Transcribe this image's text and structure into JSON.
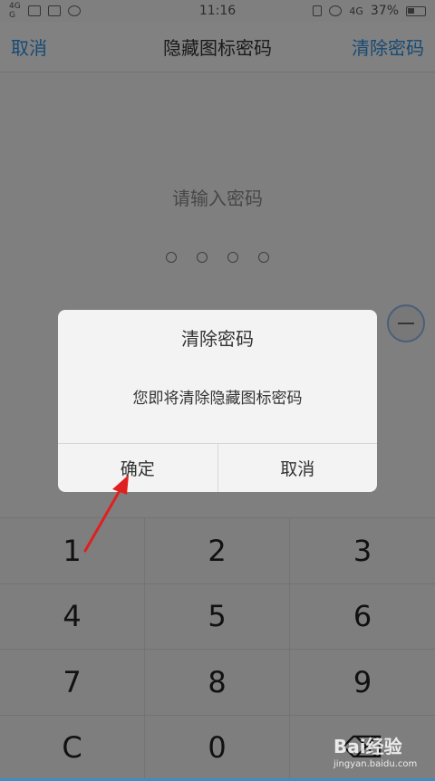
{
  "status_bar": {
    "signal_top": "4G",
    "signal_bottom": "G",
    "time": "11:16",
    "network": "4G",
    "battery": "37%",
    "icons": [
      "image-icon",
      "k-icon",
      "shield-icon",
      "vibrate-icon",
      "alarm-icon",
      "battery-icon"
    ]
  },
  "header": {
    "left_action": "取消",
    "title": "隐藏图标密码",
    "right_action": "清除密码"
  },
  "prompt": "请输入密码",
  "pin_dots": 4,
  "keypad": {
    "keys": [
      "1",
      "2",
      "3",
      "4",
      "5",
      "6",
      "7",
      "8",
      "9",
      "C",
      "0",
      "⌫"
    ]
  },
  "dialog": {
    "title": "清除密码",
    "message": "您即将清除隐藏图标密码",
    "confirm": "确定",
    "cancel": "取消"
  },
  "annotation": {
    "color": "#e02020"
  },
  "watermark": {
    "brand": "Bai经验",
    "url": "jingyan.baidu.com"
  },
  "colors": {
    "accent": "#2d8fdc"
  }
}
